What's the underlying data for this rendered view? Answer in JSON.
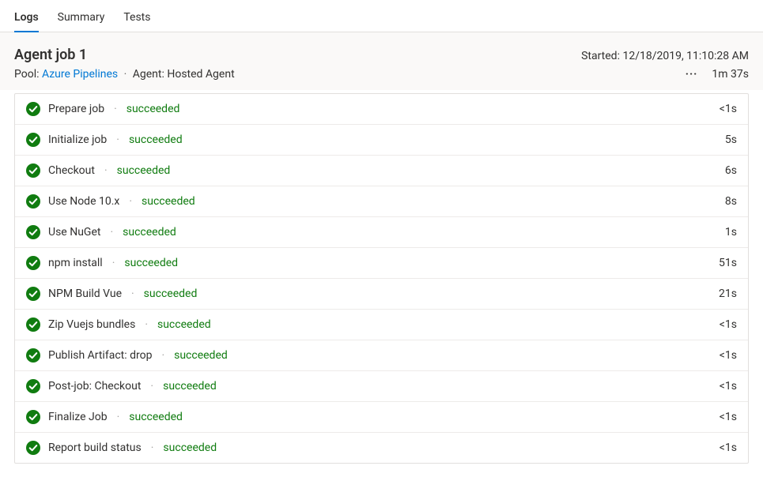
{
  "tabs": [
    {
      "label": "Logs",
      "active": true
    },
    {
      "label": "Summary",
      "active": false
    },
    {
      "label": "Tests",
      "active": false
    }
  ],
  "header": {
    "title": "Agent job 1",
    "started_label": "Started:",
    "started_value": "12/18/2019, 11:10:28 AM",
    "pool_label": "Pool:",
    "pool_name": "Azure Pipelines",
    "agent_label": "Agent:",
    "agent_name": "Hosted Agent",
    "duration": "1m 37s"
  },
  "status_text": "succeeded",
  "steps": [
    {
      "name": "Prepare job",
      "status": "succeeded",
      "time": "<1s"
    },
    {
      "name": "Initialize job",
      "status": "succeeded",
      "time": "5s"
    },
    {
      "name": "Checkout",
      "status": "succeeded",
      "time": "6s"
    },
    {
      "name": "Use Node 10.x",
      "status": "succeeded",
      "time": "8s"
    },
    {
      "name": "Use NuGet",
      "status": "succeeded",
      "time": "1s"
    },
    {
      "name": "npm install",
      "status": "succeeded",
      "time": "51s"
    },
    {
      "name": "NPM Build Vue",
      "status": "succeeded",
      "time": "21s"
    },
    {
      "name": "Zip Vuejs bundles",
      "status": "succeeded",
      "time": "<1s"
    },
    {
      "name": "Publish Artifact: drop",
      "status": "succeeded",
      "time": "<1s"
    },
    {
      "name": "Post-job: Checkout",
      "status": "succeeded",
      "time": "<1s"
    },
    {
      "name": "Finalize Job",
      "status": "succeeded",
      "time": "<1s"
    },
    {
      "name": "Report build status",
      "status": "succeeded",
      "time": "<1s"
    }
  ]
}
